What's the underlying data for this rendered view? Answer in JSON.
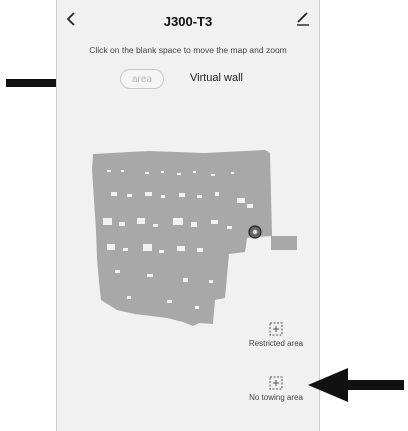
{
  "header": {
    "title": "J300-T3"
  },
  "hint": "Click on the blank space to move the map and zoom",
  "modes": {
    "area": "area",
    "virtual_wall": "Virtual wall"
  },
  "tools": {
    "restricted_area": "Restricted area",
    "no_towing_area": "No towing area"
  },
  "colors": {
    "map": "#a8a8a8",
    "background": "#f1f1f1",
    "arrow": "#111111"
  },
  "icons": {
    "back": "chevron-left-icon",
    "edit": "pencil-icon",
    "robot": "robot-position-icon",
    "restricted": "restricted-area-icon",
    "no_towing": "no-towing-area-icon"
  }
}
